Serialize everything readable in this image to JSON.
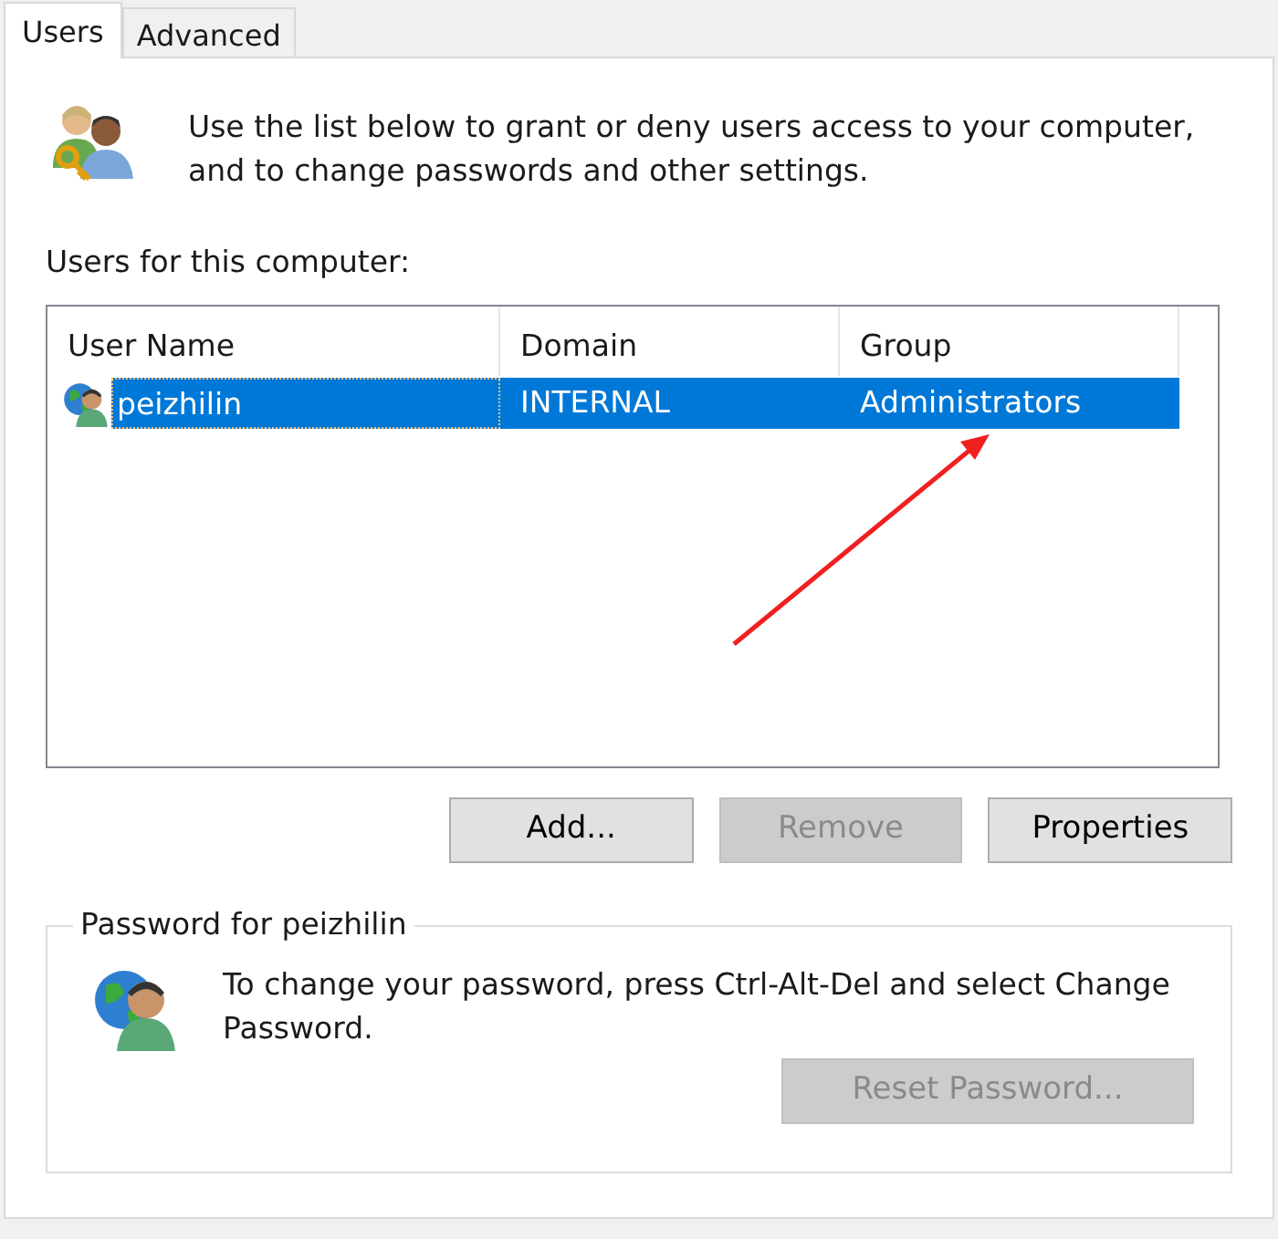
{
  "tabs": [
    {
      "label": "Users",
      "selected": true
    },
    {
      "label": "Advanced",
      "selected": false
    }
  ],
  "intro": "Use the list below to grant or deny users access to your computer, and to change passwords and other settings.",
  "users_label": {
    "text": "Users for this computer:"
  },
  "table": {
    "columns": [
      "User Name",
      "Domain",
      "Group"
    ],
    "rows": [
      {
        "cells": [
          "peizhilin",
          "INTERNAL",
          "Administrators"
        ],
        "selected": true
      }
    ]
  },
  "buttons": [
    {
      "label": "Add...",
      "disabled": false
    },
    {
      "label": "Remove",
      "disabled": true
    },
    {
      "label": "Properties",
      "disabled": false
    }
  ],
  "password_group": {
    "title": "Password for peizhilin",
    "text": "To change your password, press Ctrl-Alt-Del and select Change Password.",
    "button": {
      "label": "Reset Password...",
      "disabled": true
    }
  }
}
